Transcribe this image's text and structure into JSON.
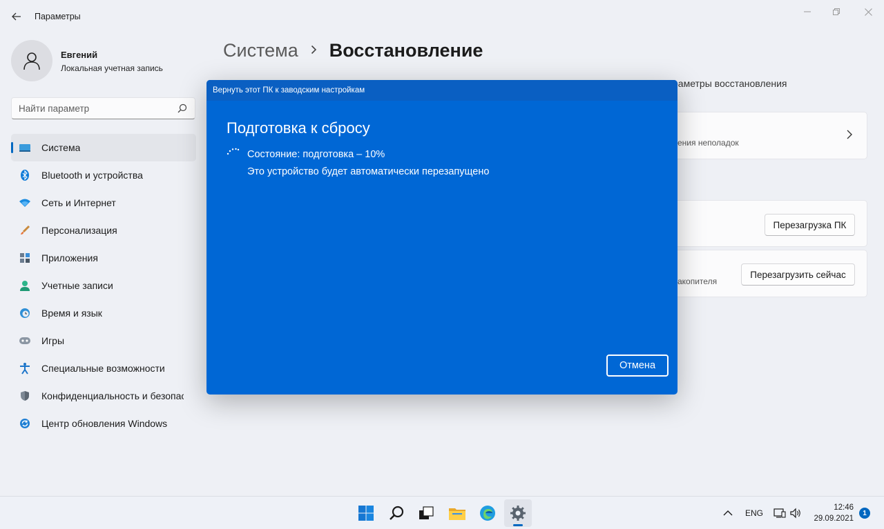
{
  "window": {
    "title": "Параметры"
  },
  "profile": {
    "name": "Евгений",
    "account_type": "Локальная учетная запись"
  },
  "search": {
    "placeholder": "Найти параметр"
  },
  "sidebar": {
    "items": [
      {
        "label": "Система",
        "icon": "monitor-icon",
        "active": true
      },
      {
        "label": "Bluetooth и устройства",
        "icon": "bluetooth-icon"
      },
      {
        "label": "Сеть и Интернет",
        "icon": "wifi-icon"
      },
      {
        "label": "Персонализация",
        "icon": "brush-icon"
      },
      {
        "label": "Приложения",
        "icon": "apps-icon"
      },
      {
        "label": "Учетные записи",
        "icon": "person-icon"
      },
      {
        "label": "Время и язык",
        "icon": "globe-clock-icon"
      },
      {
        "label": "Игры",
        "icon": "gamepad-icon"
      },
      {
        "label": "Специальные возможности",
        "icon": "accessibility-icon"
      },
      {
        "label": "Конфиденциальность и безопасность",
        "icon": "shield-icon"
      },
      {
        "label": "Центр обновления Windows",
        "icon": "update-icon"
      }
    ]
  },
  "main": {
    "breadcrumb_parent": "Система",
    "breadcrumb_current": "Восстановление",
    "subtitle": "раметры восстановления",
    "card1_text": "ения неполадок",
    "card3_text": "акопителя",
    "reset_button": "Перезагрузка ПК",
    "restart_button": "Перезагрузить сейчас"
  },
  "dialog": {
    "title": "Вернуть этот ПК к заводским настройкам",
    "heading": "Подготовка к сбросу",
    "status": "Состояние: подготовка – 10%",
    "note": "Это устройство будет автоматически перезапущено",
    "cancel": "Отмена"
  },
  "taskbar": {
    "language": "ENG",
    "time": "12:46",
    "date": "29.09.2021",
    "notifications": "1"
  },
  "colors": {
    "accent": "#0067c0",
    "dialog_bg": "#0067d5"
  }
}
